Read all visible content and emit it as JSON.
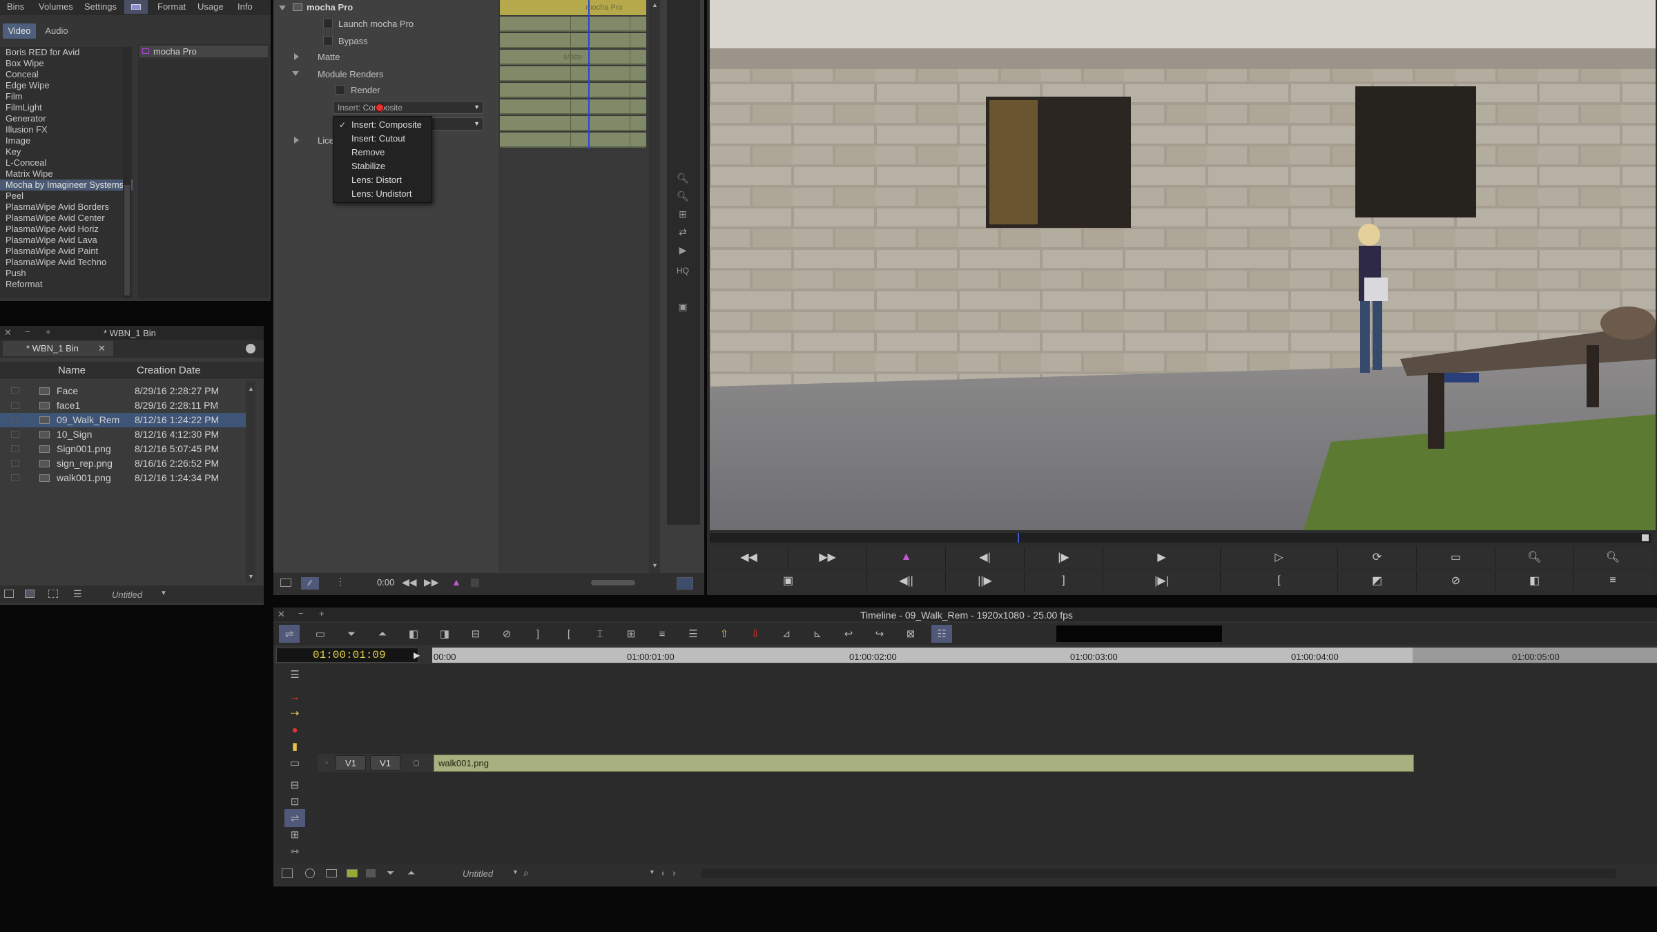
{
  "effects_palette": {
    "tabs": [
      "Bins",
      "Volumes",
      "Settings",
      "Format",
      "Usage",
      "Info"
    ],
    "subtabs": [
      "Video",
      "Audio"
    ],
    "categories": [
      "Boris RED for Avid",
      "Box Wipe",
      "Conceal",
      "Edge Wipe",
      "Film",
      "FilmLight",
      "Generator",
      "Illusion FX",
      "Image",
      "Key",
      "L-Conceal",
      "Matrix Wipe",
      "Mocha by Imagineer Systems",
      "Peel",
      "PlasmaWipe Avid Borders",
      "PlasmaWipe Avid Center",
      "PlasmaWipe Avid Horiz",
      "PlasmaWipe Avid Lava",
      "PlasmaWipe Avid Paint",
      "PlasmaWipe Avid Techno",
      "Push",
      "Reformat"
    ],
    "selected_category_index": 12,
    "effects": [
      "mocha Pro"
    ]
  },
  "bin": {
    "window_title": "* WBN_1 Bin",
    "tab_label": "* WBN_1 Bin",
    "columns": [
      "Name",
      "Creation Date"
    ],
    "rows": [
      {
        "name": "Face",
        "date": "8/29/16 2:28:27 PM"
      },
      {
        "name": "face1",
        "date": "8/29/16 2:28:11 PM"
      },
      {
        "name": "09_Walk_Rem",
        "date": "8/12/16 1:24:22 PM"
      },
      {
        "name": "10_Sign",
        "date": "8/12/16 4:12:30 PM"
      },
      {
        "name": "Sign001.png",
        "date": "8/12/16 5:07:45 PM"
      },
      {
        "name": "sign_rep.png",
        "date": "8/16/16 2:26:52 PM"
      },
      {
        "name": "walk001.png",
        "date": "8/12/16 1:24:34 PM"
      }
    ],
    "selected_row_index": 2,
    "view_label": "Untitled"
  },
  "effect_editor": {
    "effect_name": "mocha Pro",
    "launch_label": "Launch mocha Pro",
    "bypass_label": "Bypass",
    "matte_label": "Matte",
    "module_renders_label": "Module Renders",
    "render_label": "Render",
    "dropdown_value": "Insert: Composite",
    "license_label": "Lice",
    "timecode": "0:00",
    "keyframe_track_label": "mocha Pro",
    "matte_track_label": "Matte"
  },
  "dropdown_menu": {
    "items": [
      "Insert: Composite",
      "Insert: Cutout",
      "Remove",
      "Stabilize",
      "Lens: Distort",
      "Lens: Undistort"
    ],
    "checked_index": 0
  },
  "editor_tools": {
    "hq_label": "HQ"
  },
  "timeline": {
    "title": "Timeline - 09_Walk_Rem - 1920x1080 - 25.00 fps",
    "current_timecode": "01:00:01:09",
    "ruler_labels": [
      "00:00",
      "01:00:01:00",
      "01:00:02:00",
      "01:00:03:00",
      "01:00:04:00",
      "01:00:05:00"
    ],
    "track_source": "V1",
    "track_record": "V1",
    "clip_name": "walk001.png",
    "bottom_label": "Untitled"
  },
  "colors": {
    "clip": "#a8b080",
    "timecode_text": "#e6d64a",
    "selection": "#3e5578",
    "keyframe_cell": "#808a68"
  },
  "icons": [
    "plus-icon",
    "minus-icon",
    "close-icon",
    "rewind-icon",
    "fast-forward-icon",
    "play-icon",
    "step-back-icon",
    "step-forward-icon",
    "mark-in-icon",
    "mark-out-icon",
    "zoom-in-icon",
    "zoom-out-icon",
    "search-icon",
    "lift-icon",
    "extract-icon",
    "splice-in-icon",
    "overwrite-icon"
  ]
}
